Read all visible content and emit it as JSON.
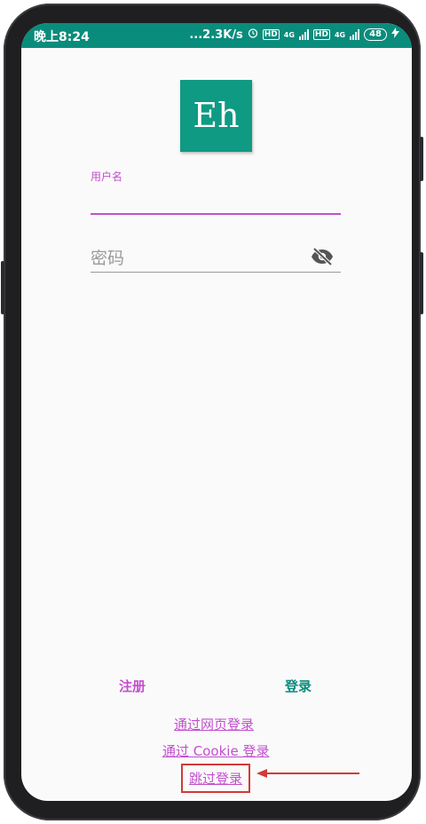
{
  "status_bar": {
    "time": "晚上8:24",
    "speed": "...2.3K/s",
    "net1": "4G",
    "net2": "4G",
    "hd": "HD",
    "battery": "48",
    "bg_color": "#0a8c7c"
  },
  "app": {
    "logo_text": "Eh",
    "logo_color": "#0f9a84"
  },
  "login_form": {
    "username_label": "用户名",
    "username_value": "",
    "password_placeholder": "密码",
    "password_value": "",
    "accent_color": "#c24fcf"
  },
  "actions": {
    "register_label": "注册",
    "login_label": "登录"
  },
  "links": {
    "web_login": "通过网页登录",
    "cookie_login": "通过 Cookie 登录",
    "skip_login": "跳过登录"
  },
  "annotation": {
    "highlight_color": "#d33a3a"
  }
}
